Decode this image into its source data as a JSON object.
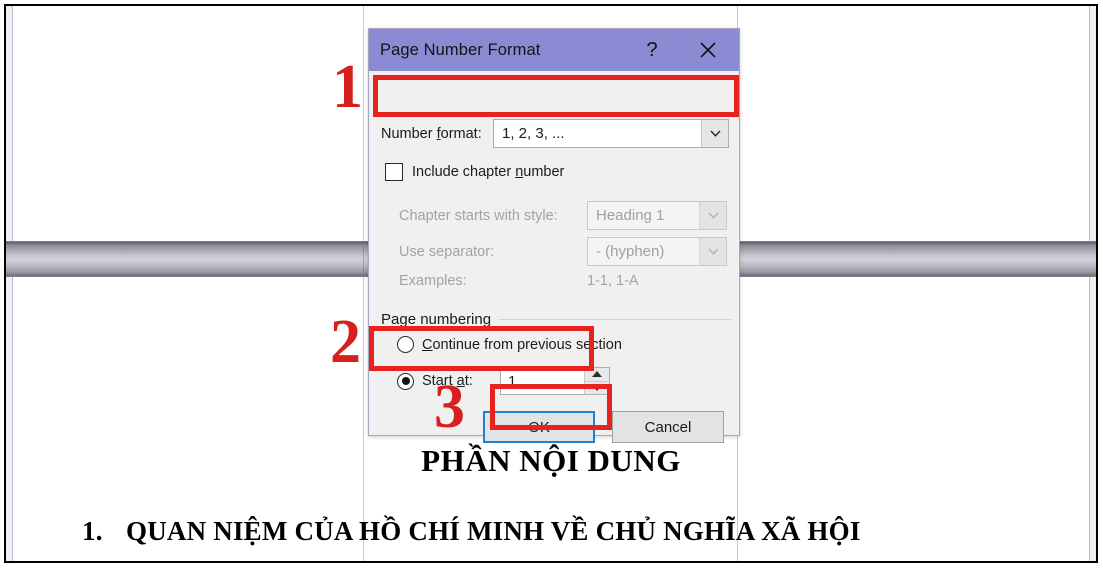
{
  "document": {
    "heading": "PHẦN NỘI DUNG",
    "list_number": "1.",
    "list_text": "QUAN NIỆM CỦA HỒ CHÍ MINH VỀ CHỦ NGHĨA XÃ HỘI"
  },
  "dialog": {
    "title": "Page Number Format",
    "help_glyph": "?",
    "number_format": {
      "label_before": "Number ",
      "label_underlined": "f",
      "label_after": "ormat:",
      "value": "1, 2, 3, ..."
    },
    "include_chapter": {
      "label_before": "Include chapter ",
      "label_underlined": "n",
      "label_after": "umber",
      "checked": false
    },
    "chapter_style": {
      "label": "Chapter starts with style:",
      "value": "Heading 1",
      "disabled": true
    },
    "use_separator": {
      "label": "Use separator:",
      "value": "-   (hyphen)",
      "disabled": true
    },
    "examples": {
      "label": "Examples:",
      "value": "1-1, 1-A",
      "disabled": true
    },
    "page_numbering": {
      "group_label": "Page numbering",
      "continue_option": {
        "label_before": "",
        "label_underlined": "C",
        "label_after": "ontinue from previous section",
        "selected": false
      },
      "start_at_option": {
        "label_before": "Start ",
        "label_underlined": "a",
        "label_after": "t:",
        "selected": true,
        "value": "1"
      }
    },
    "buttons": {
      "ok": "OK",
      "cancel": "Cancel"
    }
  },
  "annotations": {
    "step1": "1",
    "step2": "2",
    "step3": "3",
    "color": "#e8231f"
  }
}
